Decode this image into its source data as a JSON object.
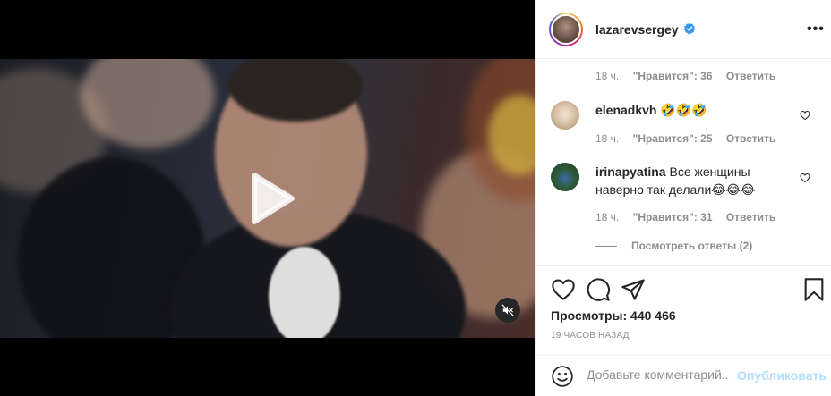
{
  "post": {
    "username": "lazarevsergey",
    "verified": true
  },
  "comments": {
    "first_meta": {
      "time": "18 ч.",
      "likes": "\"Нравится\": 36",
      "reply": "Ответить"
    },
    "items": [
      {
        "username": "elenadkvh",
        "text": "🤣🤣🤣",
        "time": "18 ч.",
        "likes": "\"Нравится\": 25",
        "reply": "Ответить"
      },
      {
        "username": "irinapyatina",
        "text_line1": "Все женщины",
        "text_line2": "наверно так делали😂😂😂",
        "time": "18 ч.",
        "likes": "\"Нравится\": 31",
        "reply": "Ответить"
      }
    ],
    "view_replies": "Посмотреть ответы (2)"
  },
  "stats": {
    "views_label": "Просмотры: 440 466",
    "time_ago": "19 часов назад"
  },
  "add_comment": {
    "placeholder": "Добавьте комментарий...",
    "post_label": "Опубликовать"
  },
  "colors": {
    "accent": "#0095f6",
    "accent_disabled": "#b2dffc",
    "text": "#262626",
    "muted": "#8e8e8e",
    "border": "#efefef"
  },
  "icons": [
    "play-icon",
    "mute-icon",
    "verified-icon",
    "more-icon",
    "heart-icon",
    "comment-icon",
    "share-icon",
    "bookmark-icon",
    "emoji-icon"
  ]
}
